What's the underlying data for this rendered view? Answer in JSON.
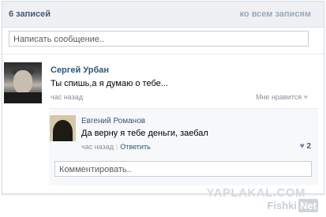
{
  "header": {
    "count_label": "6 записей",
    "all_link": "ко всем записям"
  },
  "post_box": {
    "placeholder": "Написать сообщение.."
  },
  "post": {
    "author": "Сергей Урбан",
    "text": "Ты спишь,а я думаю о тебе...",
    "time": "час назад",
    "like_label": "Мне нравится",
    "like_icon": "heart-icon"
  },
  "reply": {
    "author": "Евгений Романов",
    "text": "Да верну я тебе деньги, заебал",
    "time": "час назад",
    "separator": "|",
    "reply_label": "Ответить",
    "like_count": "2",
    "like_icon": "heart-icon"
  },
  "comment_box": {
    "placeholder": "Комментировать.."
  },
  "watermarks": {
    "yaplakal": "YAPLAKAL.COM",
    "fishki_prefix": "Fishki",
    "fishki_suffix": "Net"
  }
}
